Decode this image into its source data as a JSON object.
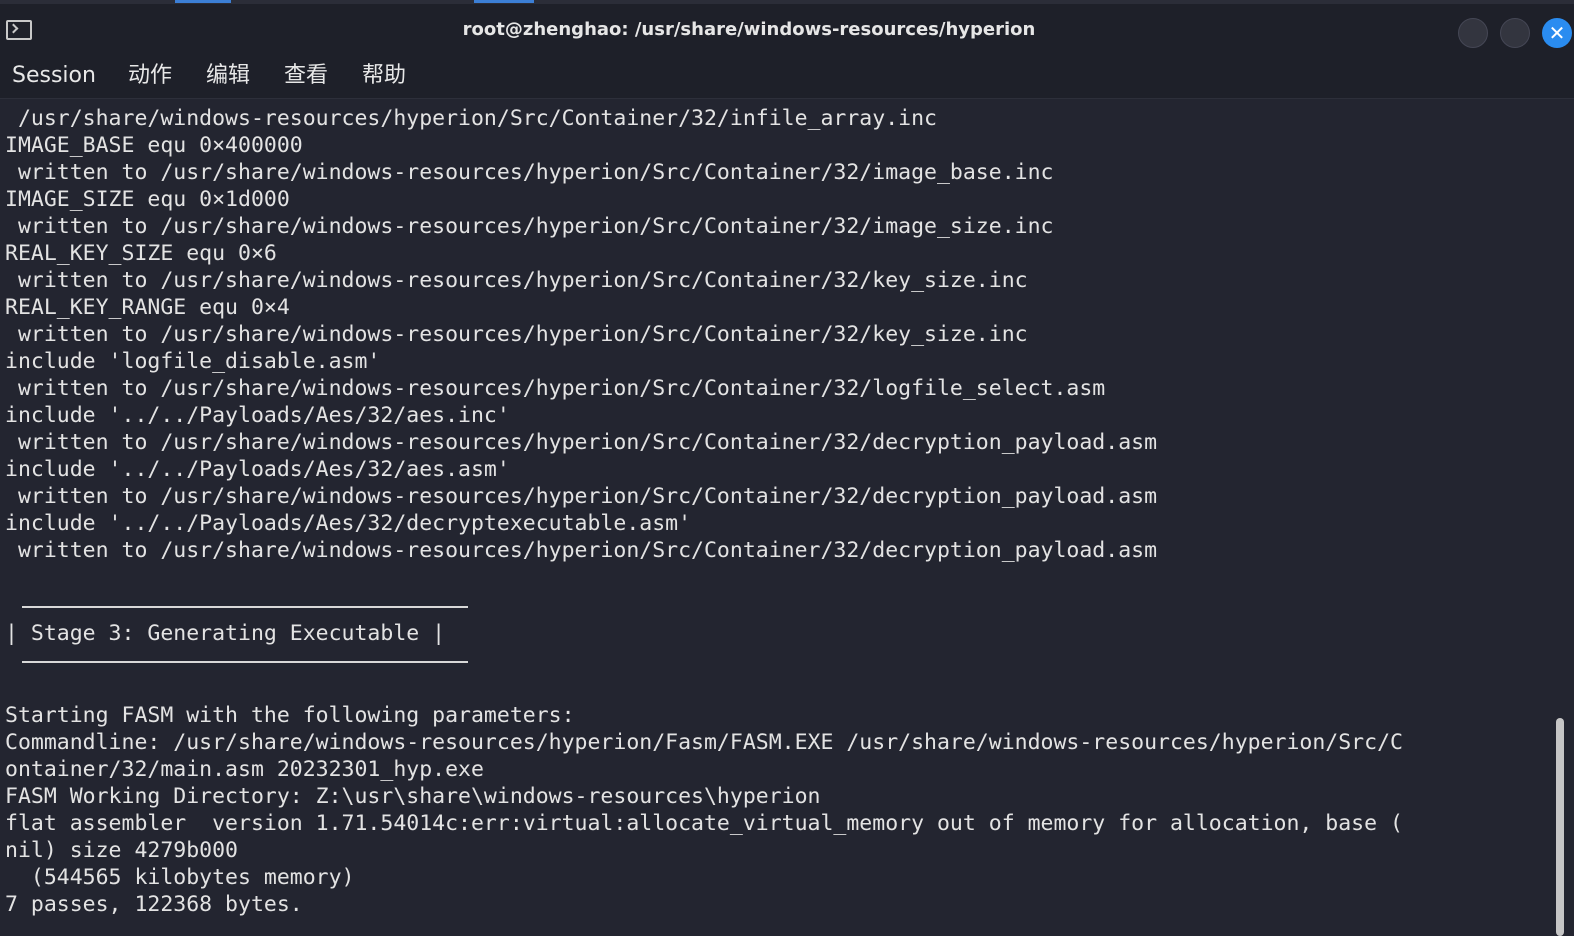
{
  "window": {
    "title": "root@zhenghao: /usr/share/windows-resources/hyperion",
    "close_glyph": "✕",
    "accent_color": "#2a8cf0",
    "background_color": "#232530",
    "icons": [
      "terminal-icon",
      "minimize-icon",
      "maximize-icon",
      "close-icon"
    ]
  },
  "menubar": {
    "items": [
      "Session",
      "动作",
      "编辑",
      "查看",
      "帮助"
    ]
  },
  "terminal": {
    "lines": [
      " /usr/share/windows-resources/hyperion/Src/Container/32/infile_array.inc",
      "IMAGE_BASE equ 0×400000",
      " written to /usr/share/windows-resources/hyperion/Src/Container/32/image_base.inc",
      "IMAGE_SIZE equ 0×1d000",
      " written to /usr/share/windows-resources/hyperion/Src/Container/32/image_size.inc",
      "REAL_KEY_SIZE equ 0×6",
      " written to /usr/share/windows-resources/hyperion/Src/Container/32/key_size.inc",
      "REAL_KEY_RANGE equ 0×4",
      " written to /usr/share/windows-resources/hyperion/Src/Container/32/key_size.inc",
      "include 'logfile_disable.asm'",
      " written to /usr/share/windows-resources/hyperion/Src/Container/32/logfile_select.asm",
      "include '../../Payloads/Aes/32/aes.inc'",
      " written to /usr/share/windows-resources/hyperion/Src/Container/32/decryption_payload.asm",
      "include '../../Payloads/Aes/32/aes.asm'",
      " written to /usr/share/windows-resources/hyperion/Src/Container/32/decryption_payload.asm",
      "include '../../Payloads/Aes/32/decryptexecutable.asm'",
      " written to /usr/share/windows-resources/hyperion/Src/Container/32/decryption_payload.asm"
    ],
    "stage_banner": "| Stage 3: Generating Executable |",
    "output_lines": [
      "Starting FASM with the following parameters:",
      "Commandline: /usr/share/windows-resources/hyperion/Fasm/FASM.EXE /usr/share/windows-resources/hyperion/Src/C",
      "ontainer/32/main.asm 20232301_hyp.exe",
      "FASM Working Directory: Z:\\usr\\share\\windows-resources\\hyperion",
      "flat assembler  version 1.71.54014c:err:virtual:allocate_virtual_memory out of memory for allocation, base (",
      "nil) size 4279b000",
      "  (544565 kilobytes memory)",
      "7 passes, 122368 bytes."
    ]
  }
}
